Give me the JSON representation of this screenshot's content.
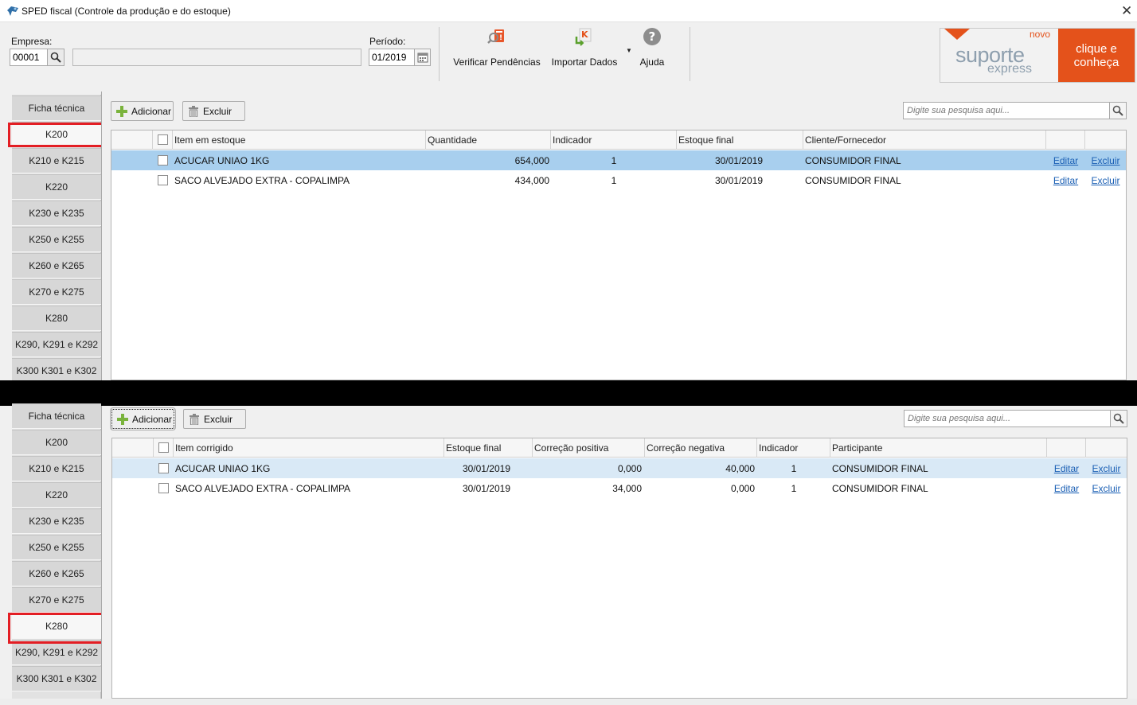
{
  "window": {
    "title": "SPED fiscal (Controle da produção e do estoque)",
    "close_glyph": "✕"
  },
  "toolbar": {
    "empresa_label": "Empresa:",
    "empresa_value": "00001",
    "empresa_name": "",
    "periodo_label": "Período:",
    "periodo_value": "01/2019",
    "verificar_label": "Verificar Pendências",
    "importar_label": "Importar Dados",
    "ajuda_label": "Ajuda"
  },
  "ad": {
    "novo": "novo",
    "brand": "suporte",
    "sub": "express",
    "cta": "clique e conheça"
  },
  "side_tabs": [
    "Ficha técnica",
    "K200",
    "K210 e K215",
    "K220",
    "K230 e K235",
    "K250 e K255",
    "K260 e K265",
    "K270 e K275",
    "K280",
    "K290, K291 e K292",
    "K300 K301 e K302"
  ],
  "top_panel": {
    "active_tab": "K200",
    "add_label": "Adicionar",
    "delete_label": "Excluir",
    "search_placeholder": "Digite sua pesquisa aqui...",
    "columns": [
      "Item em estoque",
      "Quantidade",
      "Indicador",
      "Estoque final",
      "Cliente/Fornecedor"
    ],
    "rows": [
      {
        "item": "ACUCAR UNIAO 1KG",
        "quantidade": "654,000",
        "indicador": "1",
        "estoque_final": "30/01/2019",
        "cliente": "CONSUMIDOR FINAL",
        "edit": "Editar",
        "delete": "Excluir"
      },
      {
        "item": "SACO ALVEJADO EXTRA - COPALIMPA",
        "quantidade": "434,000",
        "indicador": "1",
        "estoque_final": "30/01/2019",
        "cliente": "CONSUMIDOR FINAL",
        "edit": "Editar",
        "delete": "Excluir"
      }
    ]
  },
  "bottom_panel": {
    "active_tab": "K280",
    "add_label": "Adicionar",
    "delete_label": "Excluir",
    "search_placeholder": "Digite sua pesquisa aqui...",
    "columns": [
      "Item corrigido",
      "Estoque final",
      "Correção positiva",
      "Correção negativa",
      "Indicador",
      "Participante"
    ],
    "rows": [
      {
        "item": "ACUCAR UNIAO 1KG",
        "estoque_final": "30/01/2019",
        "positiva": "0,000",
        "negativa": "40,000",
        "indicador": "1",
        "participante": "CONSUMIDOR FINAL",
        "edit": "Editar",
        "delete": "Excluir"
      },
      {
        "item": "SACO ALVEJADO EXTRA - COPALIMPA",
        "estoque_final": "30/01/2019",
        "positiva": "34,000",
        "negativa": "0,000",
        "indicador": "1",
        "participante": "CONSUMIDOR FINAL",
        "edit": "Editar",
        "delete": "Excluir"
      }
    ]
  },
  "colors": {
    "accent": "#e4521b",
    "selected_row": "#a8cfee",
    "selected_row_light": "#d9e9f6",
    "highlight_box": "#e31e24",
    "link": "#1a5fb4"
  }
}
